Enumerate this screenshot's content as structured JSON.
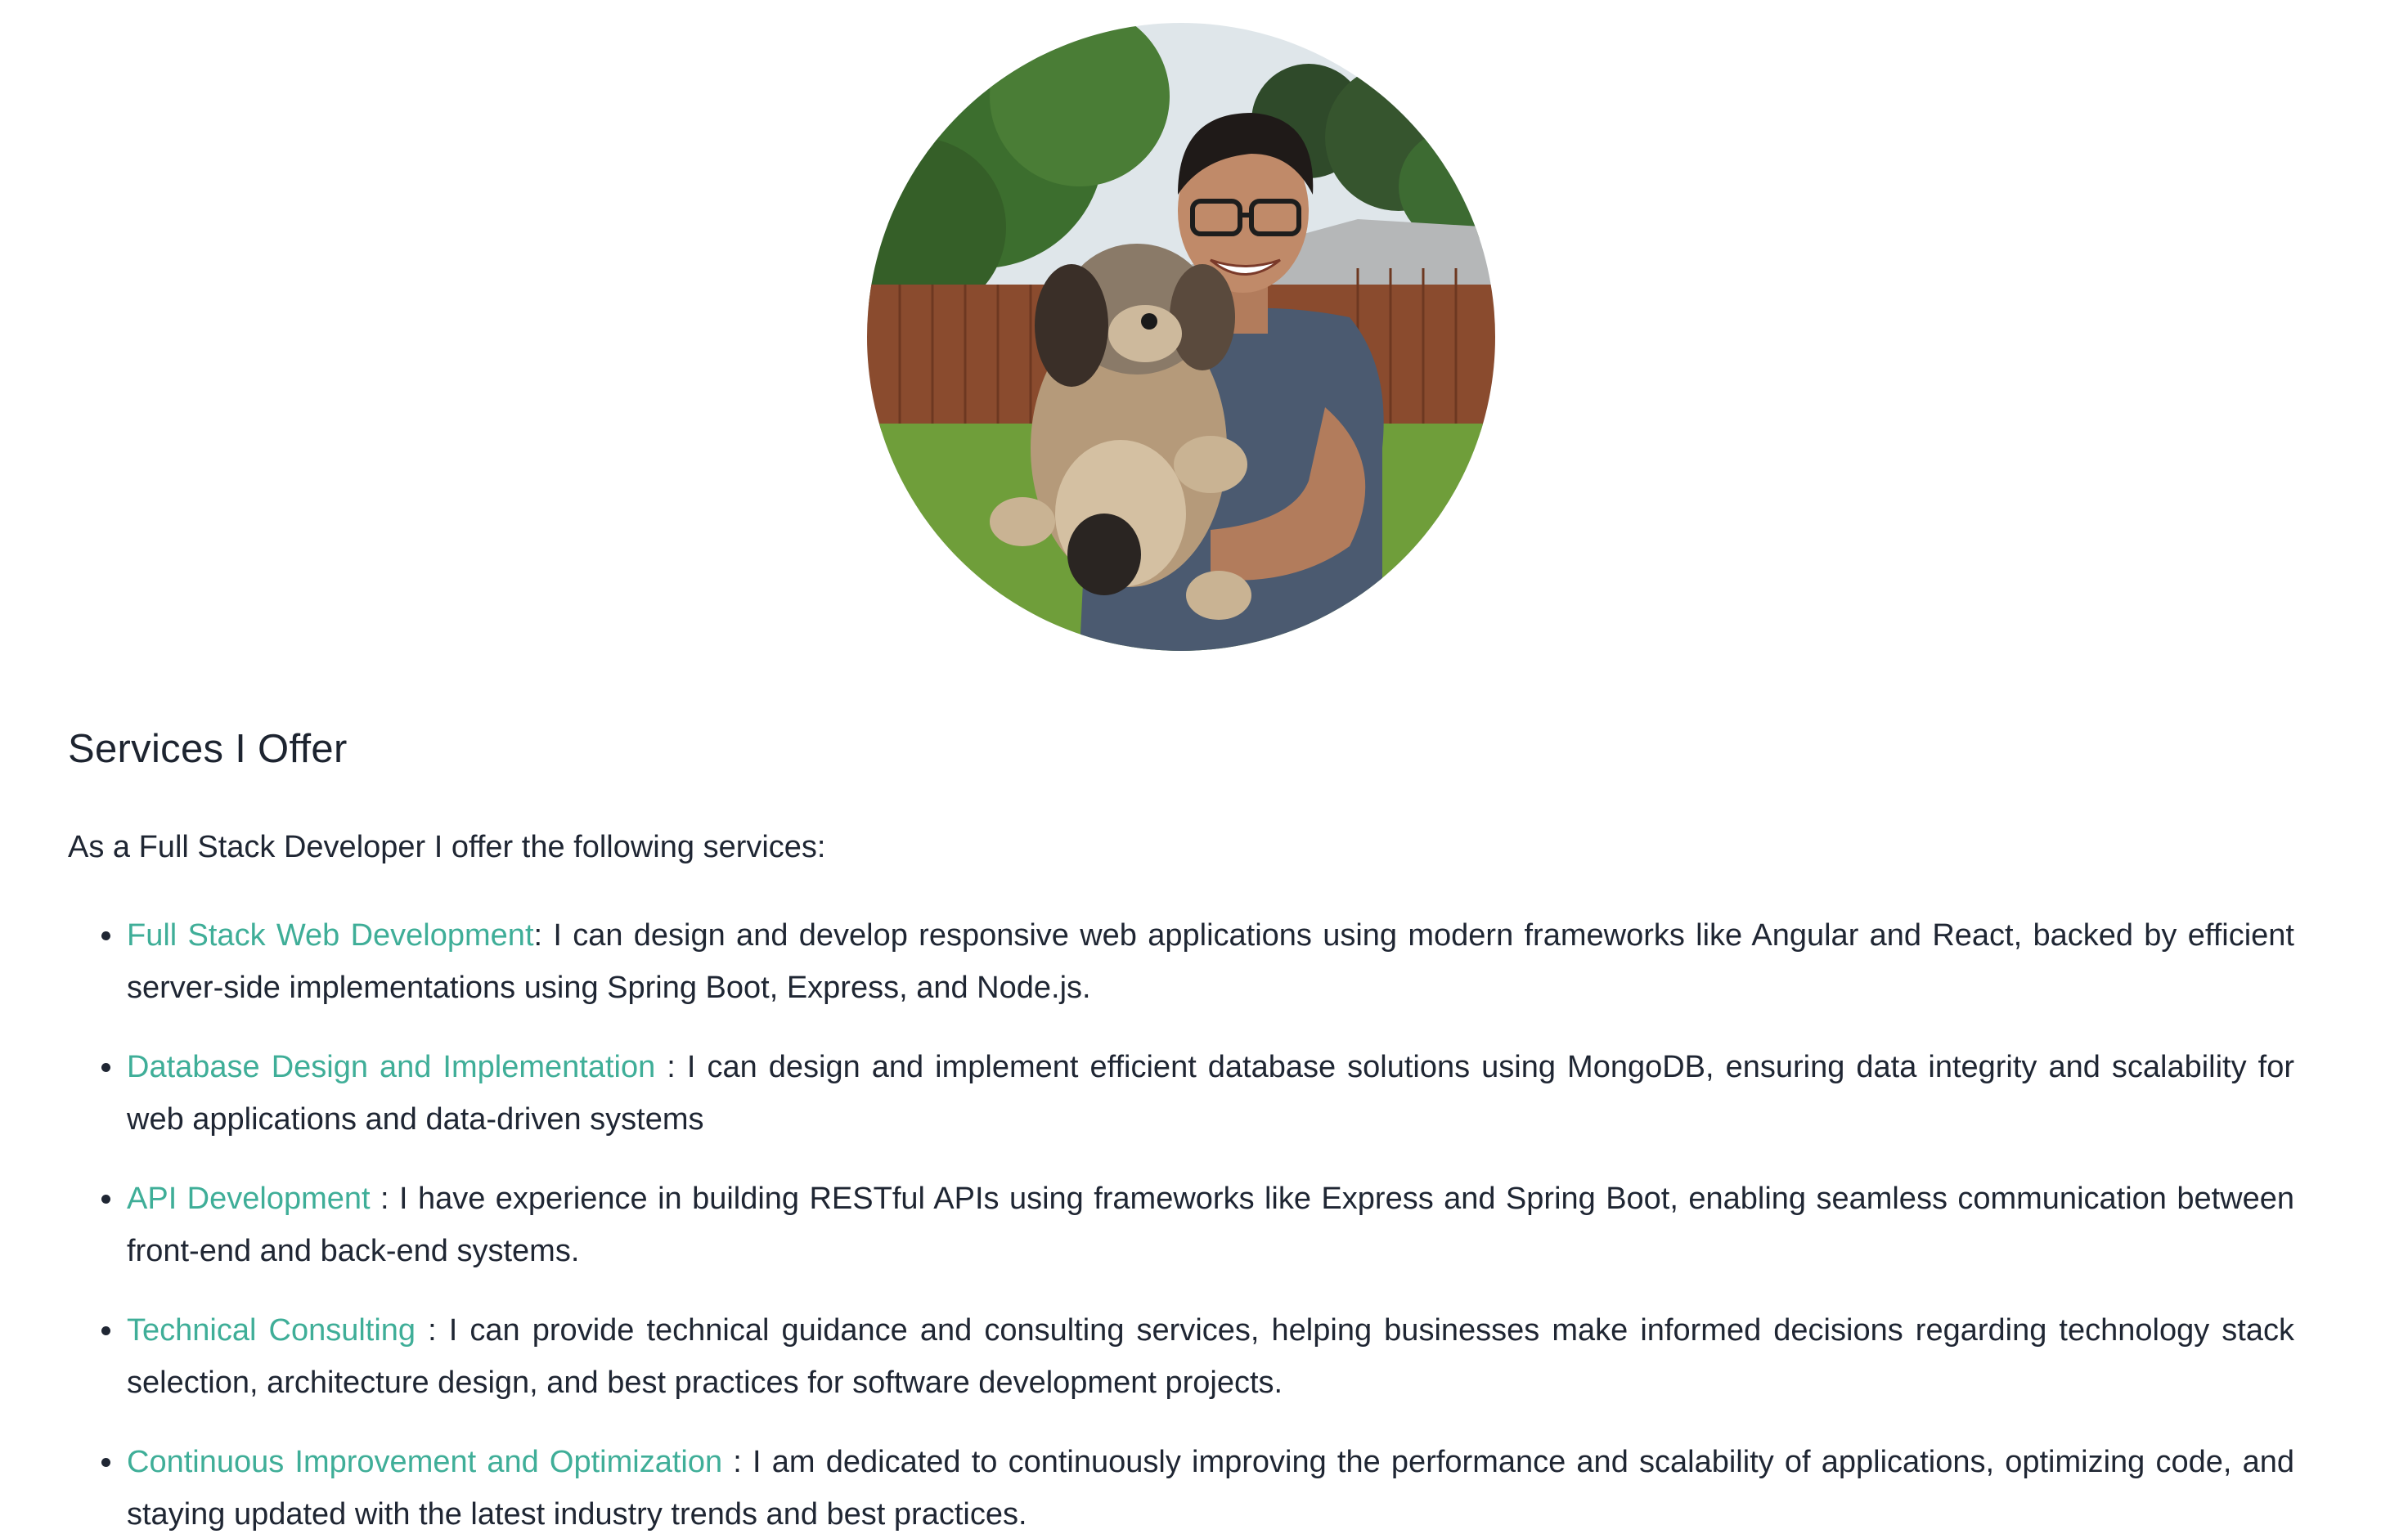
{
  "profile": {
    "photo_alt": "Developer holding a dog in a backyard"
  },
  "section": {
    "title": "Services I Offer",
    "intro": "As a Full Stack Developer I offer the following services:"
  },
  "services": [
    {
      "title": "Full Stack Web Development",
      "description": ": I can design and develop responsive web applications using modern frameworks like Angular and React, backed by efficient server-side implementations using Spring Boot, Express, and Node.js."
    },
    {
      "title": "Database Design and Implementation",
      "description": " : I can design and implement efficient database solutions using MongoDB, ensuring data integrity and scalability for web applications and data-driven systems"
    },
    {
      "title": "API Development",
      "description": " : I have experience in building RESTful APIs using frameworks like Express and Spring Boot, enabling seamless communication between front-end and back-end systems."
    },
    {
      "title": "Technical Consulting",
      "description": " : I can provide technical guidance and consulting services, helping businesses make informed decisions regarding technology stack selection, architecture design, and best practices for software development projects."
    },
    {
      "title": "Continuous Improvement and Optimization",
      "description": " : I am dedicated to continuously improving the performance and scalability of applications, optimizing code, and staying updated with the latest industry trends and best practices."
    }
  ],
  "colors": {
    "link": "#3fae98",
    "text": "#1f2633"
  }
}
